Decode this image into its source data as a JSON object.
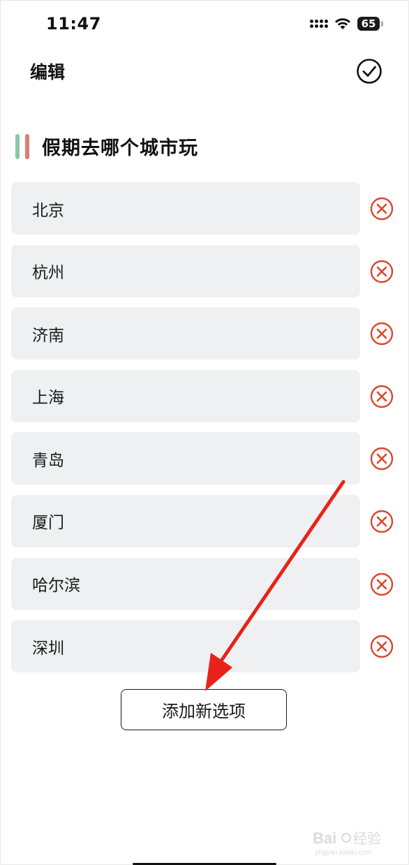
{
  "status_bar": {
    "time": "11:47",
    "battery": "65",
    "icons": [
      "signal-icon",
      "wifi-icon",
      "battery-icon"
    ]
  },
  "header": {
    "title": "编辑",
    "confirm_icon": "check-circle-icon"
  },
  "poll": {
    "title": "假期去哪个城市玩",
    "accent_colors": [
      "#8cc7a5",
      "#e07d70"
    ]
  },
  "options": [
    {
      "label": "北京"
    },
    {
      "label": "杭州"
    },
    {
      "label": "济南"
    },
    {
      "label": "上海"
    },
    {
      "label": "青岛"
    },
    {
      "label": "厦门"
    },
    {
      "label": "哈尔滨"
    },
    {
      "label": "深圳"
    }
  ],
  "add_button": {
    "label": "添加新选项"
  },
  "colors": {
    "delete": "#d9472c",
    "arrow": "#e8221b",
    "option_bg": "#eef0f1"
  }
}
